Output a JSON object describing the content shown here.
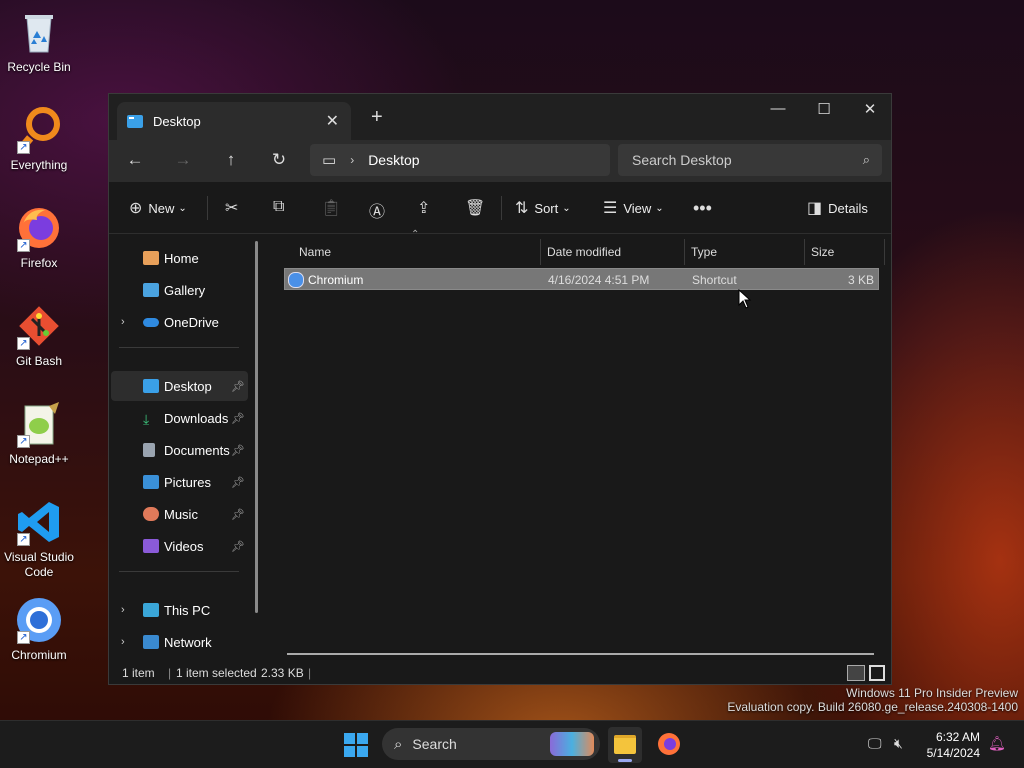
{
  "desktop_icons": [
    {
      "label": "Recycle Bin",
      "icon": "recycle-bin-icon"
    },
    {
      "label": "Everything",
      "icon": "everything-icon"
    },
    {
      "label": "Firefox",
      "icon": "firefox-icon"
    },
    {
      "label": "Git Bash",
      "icon": "git-bash-icon"
    },
    {
      "label": "Notepad++",
      "icon": "notepad-plus-plus-icon"
    },
    {
      "label": "Visual Studio Code",
      "icon": "vscode-icon"
    },
    {
      "label": "Chromium",
      "icon": "chromium-icon"
    }
  ],
  "window": {
    "tab_title": "Desktop",
    "address": "Desktop",
    "search_placeholder": "Search Desktop",
    "toolbar": {
      "new_label": "New",
      "sort_label": "Sort",
      "view_label": "View",
      "details_label": "Details"
    },
    "sidebar": {
      "home": "Home",
      "gallery": "Gallery",
      "onedrive": "OneDrive",
      "desktop": "Desktop",
      "downloads": "Downloads",
      "documents": "Documents",
      "pictures": "Pictures",
      "music": "Music",
      "videos": "Videos",
      "this_pc": "This PC",
      "network": "Network"
    },
    "columns": {
      "name": "Name",
      "date": "Date modified",
      "type": "Type",
      "size": "Size"
    },
    "files": [
      {
        "name": "Chromium",
        "date": "4/16/2024 4:51 PM",
        "type": "Shortcut",
        "size": "3 KB"
      }
    ],
    "status": {
      "items": "1 item",
      "selected": "1 item selected",
      "size": "2.33 KB"
    }
  },
  "watermark": {
    "line1": "Windows 11 Pro Insider Preview",
    "line2": "Evaluation copy. Build 26080.ge_release.240308-1400"
  },
  "taskbar": {
    "search_label": "Search",
    "time": "6:32 AM",
    "date": "5/14/2024"
  },
  "colors": {
    "accent": "#3aa0e8",
    "window_bg": "#191919",
    "selection": "#777777",
    "taskbar": "#1c1c1c"
  }
}
